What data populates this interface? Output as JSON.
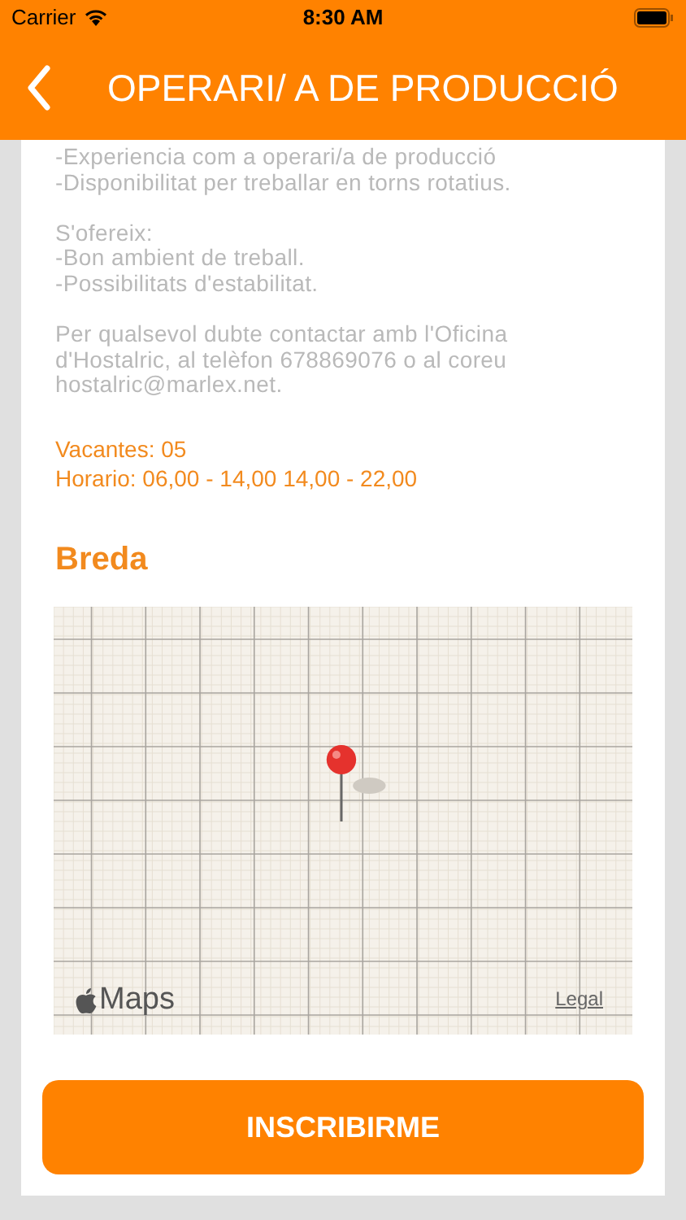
{
  "status_bar": {
    "carrier": "Carrier",
    "time": "8:30 AM"
  },
  "header": {
    "title": "OPERARI/ A DE PRODUCCIÓ"
  },
  "description": [
    [
      "-Experiencia com a operari/a de producció",
      "-Disponibilitat per treballar en torns rotatius."
    ],
    [
      "S'ofereix:",
      "-Bon ambient de treball.",
      "-Possibilitats d'estabilitat."
    ],
    [
      "Per qualsevol dubte contactar amb l'Oficina",
      "d'Hostalric, al telèfon 678869076 o al coreu",
      "hostalric@marlex.net."
    ]
  ],
  "details": [
    "Vacantes: 05",
    "Horario: 06,00 - 14,00 14,00 - 22,00"
  ],
  "location": {
    "title": "Breda"
  },
  "map": {
    "logo_text": "Maps",
    "legal": "Legal"
  },
  "button": {
    "label": "INSCRIBIRME"
  }
}
